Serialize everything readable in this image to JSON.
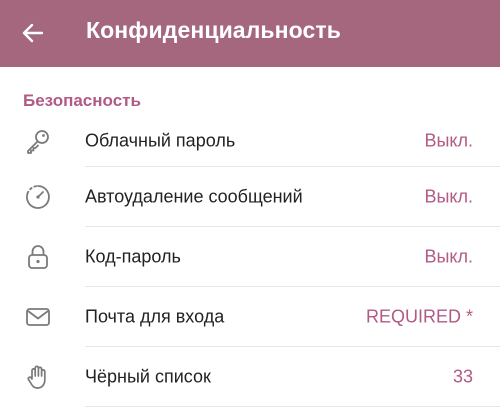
{
  "header": {
    "title": "Конфиденциальность",
    "back_icon": "arrow-left-icon",
    "background_color": "#a5677e",
    "text_color": "#ffffff"
  },
  "section": {
    "title": "Безопасность",
    "accent_color": "#b15a86"
  },
  "items": [
    {
      "icon": "key-icon",
      "label": "Облачный пароль",
      "value": "Выкл."
    },
    {
      "icon": "timer-icon",
      "label": "Автоудаление сообщений",
      "value": "Выкл."
    },
    {
      "icon": "lock-icon",
      "label": "Код-пароль",
      "value": "Выкл."
    },
    {
      "icon": "envelope-icon",
      "label": "Почта для входа",
      "value": "REQUIRED *"
    },
    {
      "icon": "hand-icon",
      "label": "Чёрный список",
      "value": "33"
    }
  ]
}
